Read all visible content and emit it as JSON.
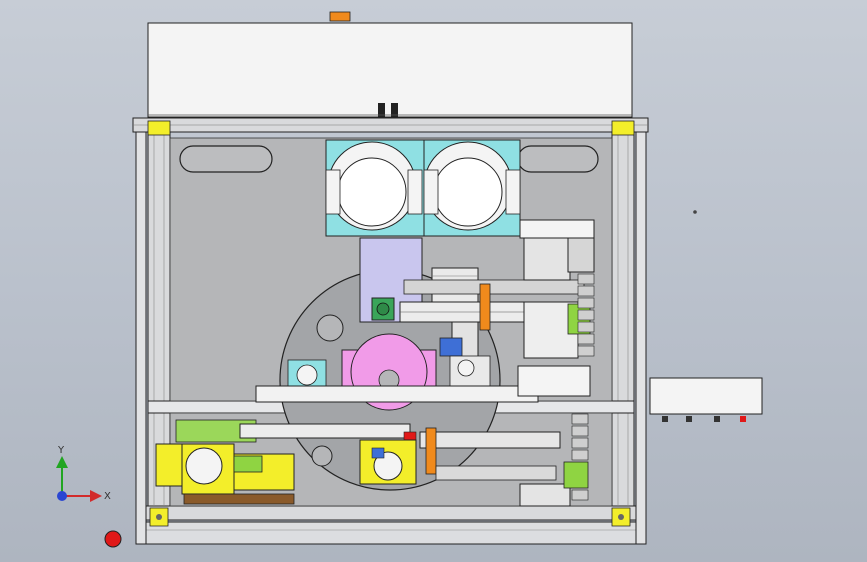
{
  "viewport": {
    "background_top": "#c7cdd6",
    "background_bottom": "#aeb5c0"
  },
  "colors": {
    "housing_white": "#f4f4f4",
    "frame_gray": "#d9dadc",
    "panel_gray": "#b5b6b8",
    "turntable": "#9ea0a3",
    "reel_cyan": "#8fe0e3",
    "motor_lavender": "#c9c6ee",
    "button_green": "#3aa55a",
    "fixture_yellow": "#f3ee2a",
    "fixture_green": "#9bd75a",
    "disc_pink": "#f19be8",
    "clamp_orange": "#f08a1c",
    "bracket_lime": "#8fd442",
    "part_blue": "#3e6fd6",
    "rail_brown": "#8a5a2a",
    "stop_red": "#e01818",
    "axis_x": "#d22a2a",
    "axis_y": "#21a521",
    "axis_z": "#2a46d2"
  },
  "triad": {
    "y_label": "Y",
    "x_label": "X"
  },
  "icons": [
    "emergency-stop-icon",
    "coordinate-triad-icon",
    "corner-bracket-icon"
  ]
}
